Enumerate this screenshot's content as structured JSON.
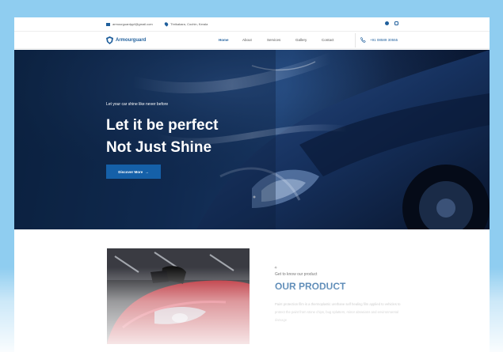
{
  "topbar": {
    "email": "armourguardppf@gmail.com",
    "address": "Thrikakara, Cochin, Kerala",
    "social": [
      "facebook-icon",
      "instagram-icon"
    ]
  },
  "nav": {
    "brand": "Armourguard",
    "menu": [
      "Home",
      "About",
      "Services",
      "Gallery",
      "Contact"
    ],
    "active": "Home",
    "phone": "+91 08589 30555"
  },
  "hero": {
    "kicker": "Let your car shine like never before",
    "title_line1": "Let it be perfect",
    "title_line2": "Not Just Shine",
    "cta": "Discover More",
    "cta_arrow": "→"
  },
  "product": {
    "sparkle": "✧",
    "eyebrow": "Get to know our product",
    "title": "OUR PRODUCT",
    "description": "Paint protection film is a thermoplastic urethane self healing film applied to vehicles to protect the paint from stone chips, bug splatters, minor abrasions and environmental damage"
  },
  "colors": {
    "brand": "#1f5f9c",
    "button": "#1560a8",
    "page_background": "#8fcdf0"
  }
}
